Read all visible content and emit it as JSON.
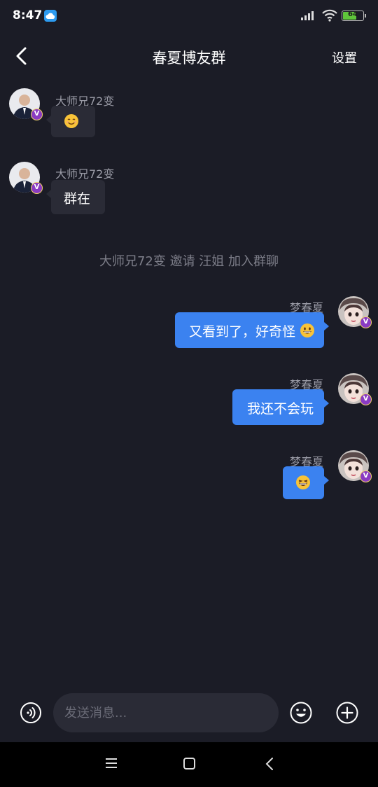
{
  "status_bar": {
    "time": "8:47",
    "battery_level": "64",
    "battery_fraction": 0.64,
    "icons": [
      "cloud-icon",
      "signal-icon",
      "wifi-icon",
      "battery-icon"
    ]
  },
  "header": {
    "title": "春夏博友群",
    "settings_label": "设置",
    "back_icon": "chevron-left-icon"
  },
  "messages": [
    {
      "sender": "大师兄72变",
      "direction": "incoming",
      "content_emoji": "smiling-face-emoji",
      "text": ""
    },
    {
      "sender": "大师兄72变",
      "direction": "incoming",
      "text": "群在"
    },
    {
      "sender": "梦春夏",
      "direction": "outgoing",
      "text": "又看到了，好奇怪",
      "trailing_emoji": "grinning-face-emoji"
    },
    {
      "sender": "梦春夏",
      "direction": "outgoing",
      "text": "我还不会玩"
    },
    {
      "sender": "梦春夏",
      "direction": "outgoing",
      "content_emoji": "laughing-face-emoji",
      "text": ""
    }
  ],
  "system_notice": "大师兄72变 邀请 汪姐 加入群聊",
  "input_bar": {
    "placeholder": "发送消息...",
    "value": "",
    "icons": [
      "voice-icon",
      "emoji-icon",
      "plus-icon"
    ]
  },
  "badge_label": "V",
  "colors": {
    "background": "#1b1c26",
    "incoming_bubble": "#2a2b36",
    "outgoing_bubble": "#3b82f0",
    "vip_badge": "#8a3bc2"
  }
}
